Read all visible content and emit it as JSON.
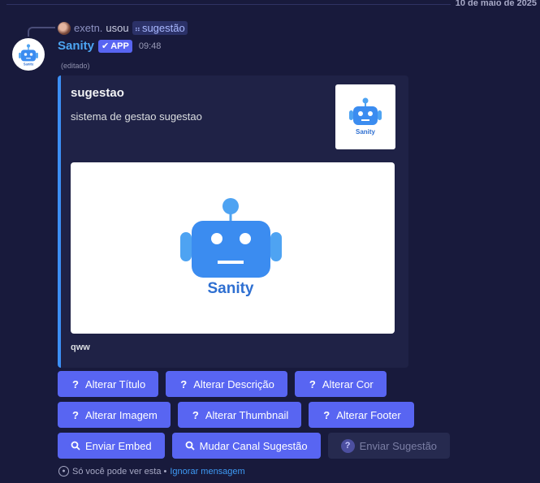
{
  "date_divider": "10 de maio de 2025",
  "reply": {
    "user": "exetn.",
    "used_text": "usou",
    "command": "sugestão"
  },
  "message": {
    "author": "Sanity",
    "badge": "APP",
    "time": "09:48",
    "edited": "(editado)",
    "accent_color": "#3c8ff5"
  },
  "embed": {
    "title": "sugestao",
    "description": "sistema de gestao sugestao",
    "footer": "qww",
    "thumbnail_logo_text": "Sanity",
    "image_logo_text": "Sanity"
  },
  "buttons": {
    "row1": [
      "Alterar Título",
      "Alterar Descrição",
      "Alterar Cor"
    ],
    "row2": [
      "Alterar Imagem",
      "Alterar Thumbnail",
      "Alterar Footer"
    ],
    "row3": [
      "Enviar Embed",
      "Mudar Canal Sugestão",
      "Enviar Sugestão"
    ]
  },
  "ephemeral": {
    "text": "Só você pode ver esta •",
    "link": "Ignorar mensagem"
  }
}
